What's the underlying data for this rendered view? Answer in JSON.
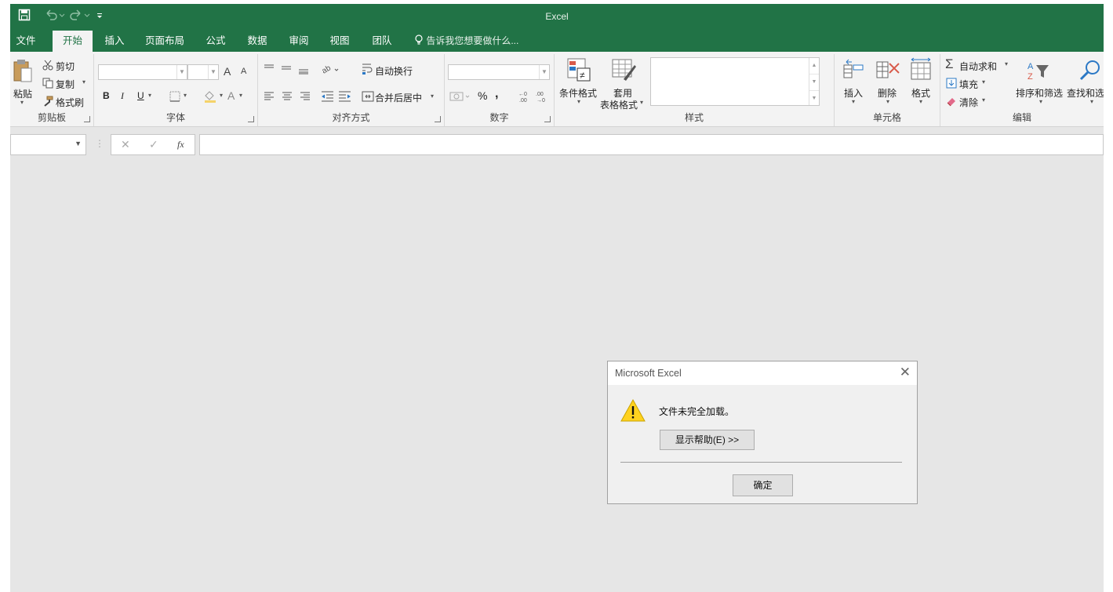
{
  "window": {
    "title": "Excel"
  },
  "qat": {
    "save_icon": "save-icon",
    "undo_icon": "undo-icon",
    "redo_icon": "redo-icon",
    "customize_icon": "customize-icon"
  },
  "tabs": [
    {
      "label": "文件"
    },
    {
      "label": "开始"
    },
    {
      "label": "插入"
    },
    {
      "label": "页面布局"
    },
    {
      "label": "公式"
    },
    {
      "label": "数据"
    },
    {
      "label": "审阅"
    },
    {
      "label": "视图"
    },
    {
      "label": "团队"
    }
  ],
  "tell_me": "告诉我您想要做什么...",
  "ribbon": {
    "clipboard": {
      "group": "剪贴板",
      "paste": "粘贴",
      "cut": "剪切",
      "copy": "复制",
      "format_painter": "格式刷"
    },
    "font": {
      "group": "字体",
      "bold": "B",
      "italic": "I",
      "underline": "U",
      "grow": "A",
      "shrink": "A",
      "color": "A"
    },
    "alignment": {
      "group": "对齐方式",
      "wrap": "自动换行",
      "merge": "合并后居中"
    },
    "number": {
      "group": "数字",
      "percent": "%",
      "comma": ","
    },
    "styles": {
      "group": "样式",
      "conditional": "条件格式",
      "table1": "套用",
      "table2": "表格格式"
    },
    "cells": {
      "group": "单元格",
      "insert": "插入",
      "delete": "删除",
      "format": "格式"
    },
    "editing": {
      "group": "编辑",
      "autosum": "自动求和",
      "fill": "填充",
      "clear": "清除",
      "sort": "排序和筛选",
      "find": "查找和选"
    }
  },
  "formula_bar": {
    "cancel": "✕",
    "enter": "✓",
    "fx": "fx"
  },
  "dialog": {
    "title": "Microsoft Excel",
    "message": "文件未完全加载。",
    "help_button": "显示帮助(E) >>",
    "ok_button": "确定"
  },
  "colors": {
    "accent": "#217346",
    "ribbon": "#f3f3f3",
    "workspace": "#e6e6e6"
  }
}
